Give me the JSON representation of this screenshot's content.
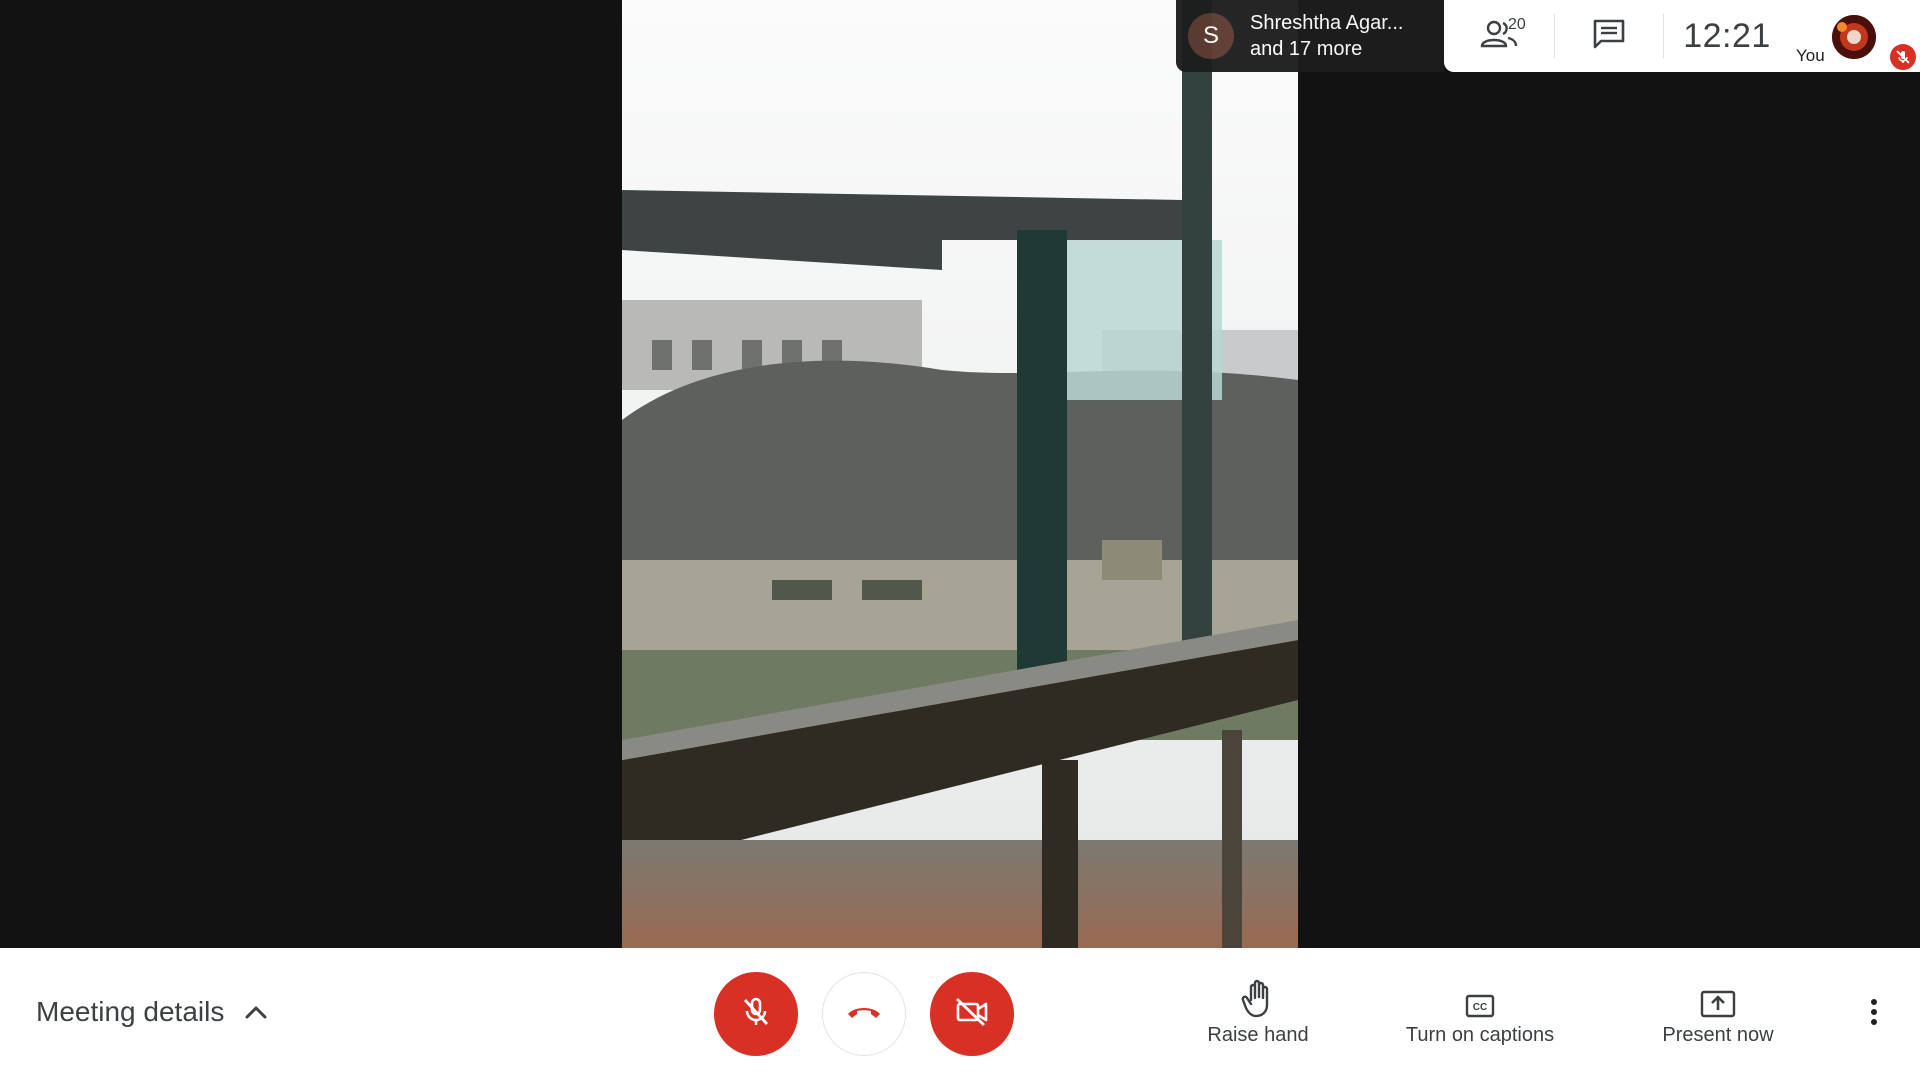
{
  "stage": {
    "video_description_icon": "camera-feed"
  },
  "top_bar": {
    "presenter": {
      "initial": "S",
      "name": "Shreshtha Agar...",
      "more": "and 17 more",
      "avatar_color": "#5c3b31"
    },
    "people_count": "20",
    "clock": "12:21",
    "self_label": "You"
  },
  "bottom_bar": {
    "meeting_details_label": "Meeting details",
    "raise_hand_label": "Raise hand",
    "captions_label": "Turn on captions",
    "present_label": "Present now"
  },
  "colors": {
    "danger": "#d93025",
    "text": "#3c4043",
    "stage": "#121212"
  }
}
